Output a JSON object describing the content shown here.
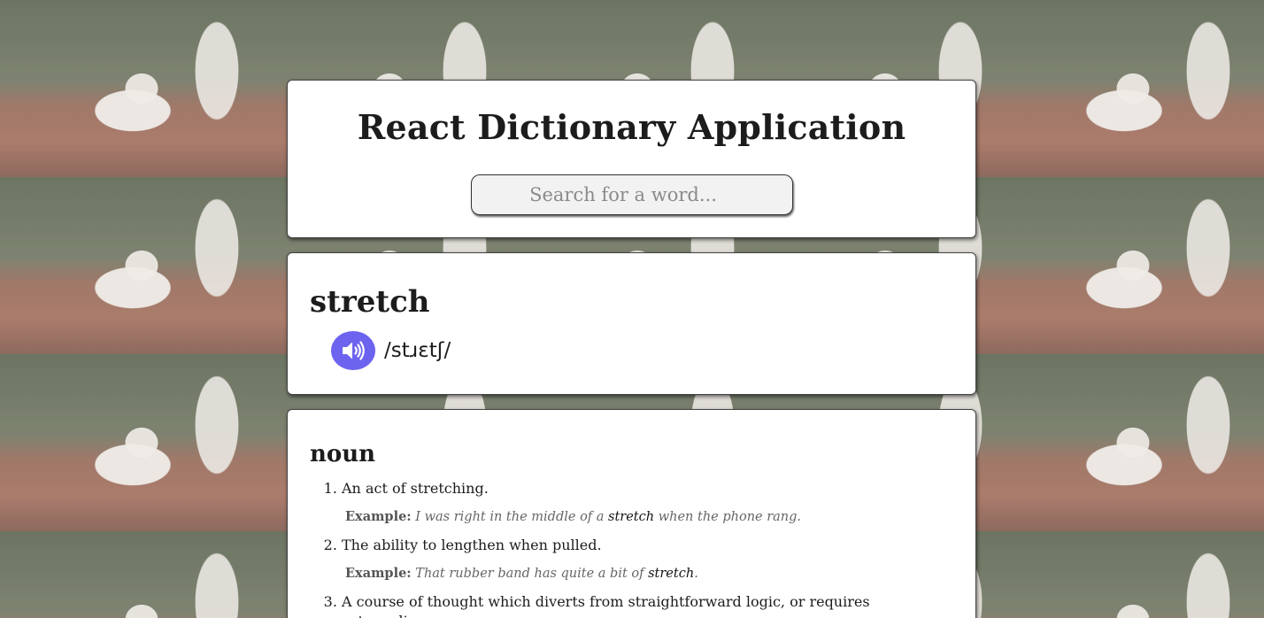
{
  "header": {
    "title": "React Dictionary Application",
    "search_placeholder": "Search for a word..."
  },
  "word_card": {
    "word": "stretch",
    "phonetic": "/stɹɛtʃ/",
    "audio_icon": "speaker-icon"
  },
  "meanings": [
    {
      "part_of_speech": "noun",
      "definitions": [
        {
          "number": "1.",
          "text": "An act of stretching.",
          "example_label": "Example:",
          "example_before": "I was right in the middle of a",
          "example_word": "stretch",
          "example_after": "when the phone rang."
        },
        {
          "number": "2.",
          "text": "The ability to lengthen when pulled.",
          "example_label": "Example:",
          "example_before": "That rubber band has quite a bit of",
          "example_word": "stretch",
          "example_after": "."
        },
        {
          "number": "3.",
          "text": "A course of thought which diverts from straightforward logic, or requires extraordinary"
        }
      ]
    }
  ],
  "colors": {
    "accent": "#6c63ef",
    "card_bg": "#ffffff"
  }
}
